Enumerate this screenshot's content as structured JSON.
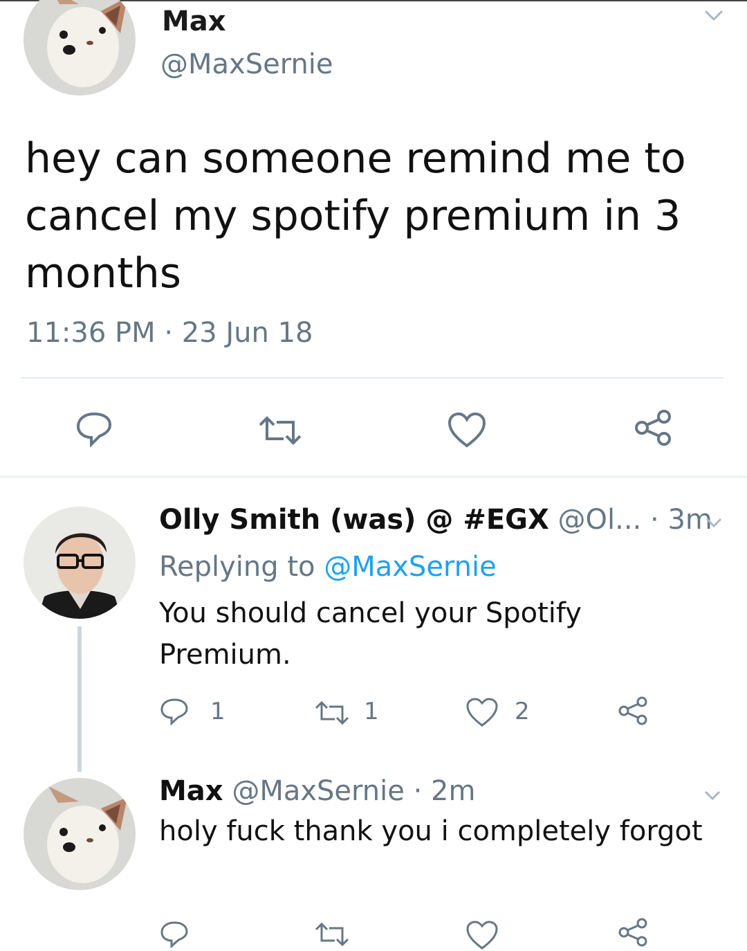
{
  "main_tweet": {
    "name": "Max",
    "handle": "@MaxSernie",
    "text": "hey can someone remind me to cancel my spotify premium in 3 months",
    "timestamp": "11:36 PM · 23 Jun 18",
    "actions": [
      "reply-icon",
      "retweet-icon",
      "like-icon",
      "share-icon"
    ]
  },
  "reply_1": {
    "name": "Olly Smith (was) @ #EGX",
    "handle": "@Ol...",
    "time": "· 3m",
    "replying_prefix": "Replying to",
    "replying_handle": "@MaxSernie",
    "text": "You should cancel your Spotify Premium.",
    "reply_count": "1",
    "retweet_count": "1",
    "like_count": "2"
  },
  "reply_2": {
    "name": "Max",
    "handle": "@MaxSernie",
    "time": "· 2m",
    "text": "holy fuck thank you i completely forgot"
  },
  "colors": {
    "text": "#14171a",
    "muted": "#657786",
    "link": "#1da1f2",
    "divider": "#e6ecf0"
  }
}
